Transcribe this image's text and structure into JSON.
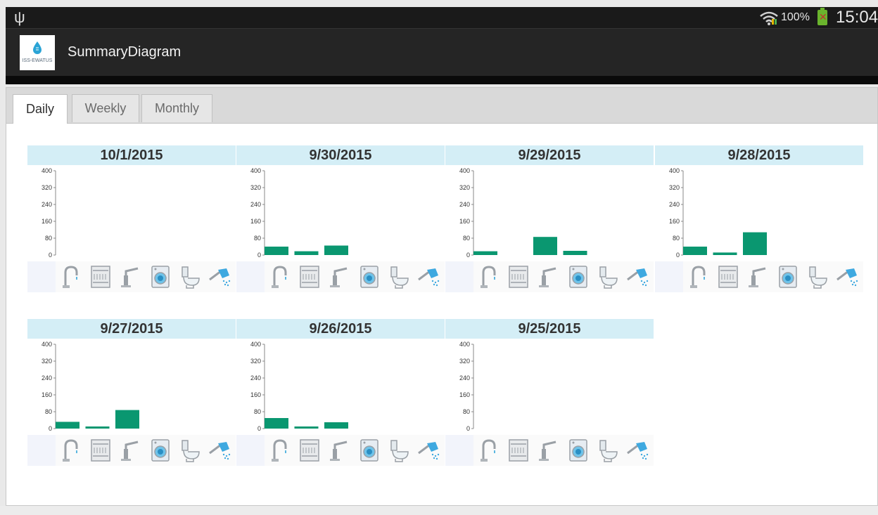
{
  "status_bar": {
    "battery_percent": "100%",
    "time": "15:04",
    "battery_icon_mark": "✕"
  },
  "app_bar": {
    "logo_text": "ISS-EWATUS",
    "title": "SummaryDiagram"
  },
  "tabs": [
    {
      "label": "Daily",
      "active": true
    },
    {
      "label": "Weekly",
      "active": false
    },
    {
      "label": "Monthly",
      "active": false
    }
  ],
  "appliance_icons": [
    "water-tap-icon",
    "dishwasher-icon",
    "kitchen-faucet-icon",
    "washing-machine-icon",
    "toilet-icon",
    "shower-icon"
  ],
  "chart_data": [
    {
      "type": "bar",
      "title": "10/1/2015",
      "y_ticks": [
        "400",
        "320",
        "240",
        "160",
        "80",
        "0"
      ],
      "ylim": [
        0,
        400
      ],
      "values": [
        0,
        0,
        0,
        0,
        0,
        0
      ]
    },
    {
      "type": "bar",
      "title": "9/30/2015",
      "y_ticks": [
        "400",
        "320",
        "240",
        "160",
        "80",
        "0"
      ],
      "ylim": [
        0,
        400
      ],
      "values": [
        40,
        18,
        45,
        0,
        0,
        0
      ]
    },
    {
      "type": "bar",
      "title": "9/29/2015",
      "y_ticks": [
        "400",
        "320",
        "240",
        "160",
        "80",
        "0"
      ],
      "ylim": [
        0,
        400
      ],
      "values": [
        18,
        0,
        86,
        20,
        0,
        0
      ]
    },
    {
      "type": "bar",
      "title": "9/28/2015",
      "y_ticks": [
        "400",
        "320",
        "240",
        "160",
        "80",
        "0"
      ],
      "ylim": [
        0,
        400
      ],
      "values": [
        40,
        12,
        108,
        0,
        0,
        0
      ]
    },
    {
      "type": "bar",
      "title": "9/27/2015",
      "y_ticks": [
        "400",
        "320",
        "240",
        "160",
        "80",
        "0"
      ],
      "ylim": [
        0,
        400
      ],
      "values": [
        32,
        10,
        88,
        0,
        0,
        0
      ]
    },
    {
      "type": "bar",
      "title": "9/26/2015",
      "y_ticks": [
        "400",
        "320",
        "240",
        "160",
        "80",
        "0"
      ],
      "ylim": [
        0,
        400
      ],
      "values": [
        50,
        10,
        30,
        0,
        0,
        0
      ]
    },
    {
      "type": "bar",
      "title": "9/25/2015",
      "y_ticks": [
        "400",
        "320",
        "240",
        "160",
        "80",
        "0"
      ],
      "ylim": [
        0,
        400
      ],
      "values": [
        0,
        0,
        0,
        0,
        0,
        0
      ]
    }
  ],
  "colors": {
    "bar": "#0a9770",
    "header_bg": "#d4eef6"
  }
}
